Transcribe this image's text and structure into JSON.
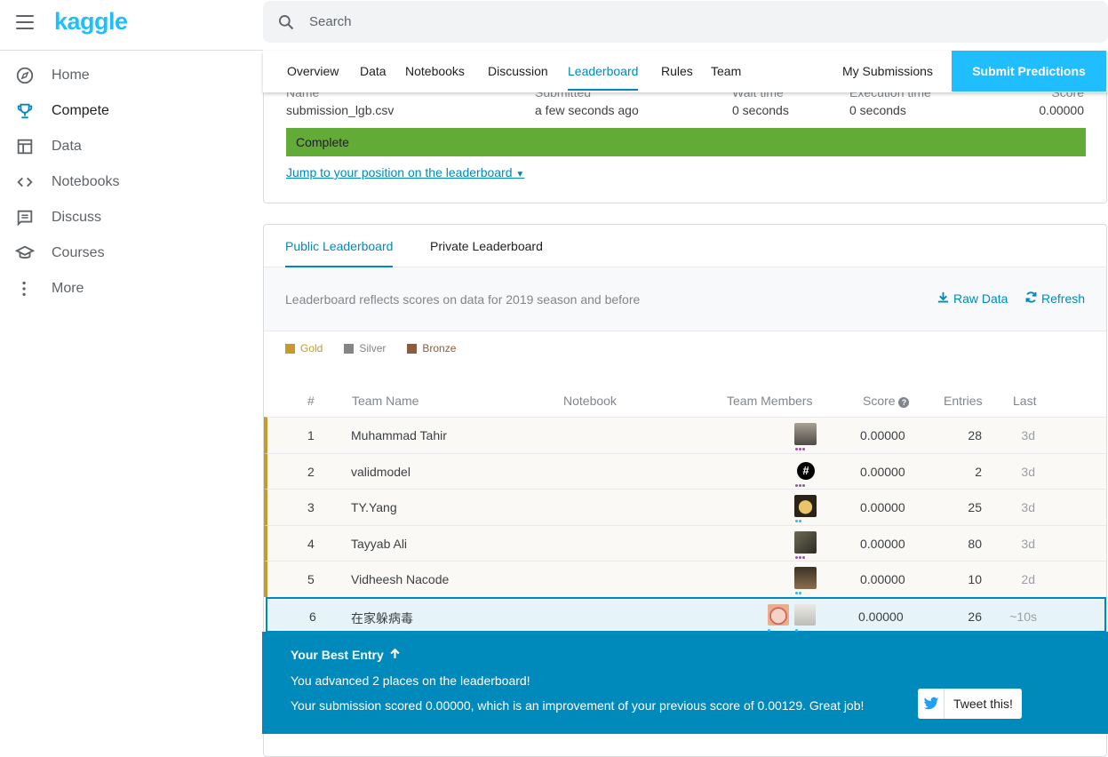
{
  "app": {
    "logo": "kaggle"
  },
  "search": {
    "placeholder": "Search"
  },
  "nav": {
    "items": [
      {
        "label": "Home",
        "icon": "compass-icon"
      },
      {
        "label": "Compete",
        "icon": "trophy-icon",
        "active": true
      },
      {
        "label": "Data",
        "icon": "table-icon"
      },
      {
        "label": "Notebooks",
        "icon": "code-icon"
      },
      {
        "label": "Discuss",
        "icon": "comment-icon"
      },
      {
        "label": "Courses",
        "icon": "school-icon"
      },
      {
        "label": "More",
        "icon": "more-vert-icon"
      }
    ]
  },
  "tabs": {
    "items": [
      "Overview",
      "Data",
      "Notebooks",
      "Discussion",
      "Leaderboard",
      "Rules",
      "Team"
    ],
    "active": "Leaderboard",
    "my_submissions": "My Submissions",
    "submit": "Submit Predictions"
  },
  "submission": {
    "headers": {
      "name": "Name",
      "submitted": "Submitted",
      "wait": "Wait time",
      "exec": "Execution time",
      "score": "Score"
    },
    "values": {
      "name": "submission_lgb.csv",
      "submitted": "a few seconds ago",
      "wait": "0 seconds",
      "exec": "0 seconds",
      "score": "0.00000"
    },
    "status": "Complete",
    "jump_link": "Jump to your position on the leaderboard"
  },
  "leaderboard": {
    "tabs": {
      "public": "Public Leaderboard",
      "private": "Private Leaderboard"
    },
    "info": "Leaderboard reflects scores on data for 2019 season and before",
    "raw_data": "Raw Data",
    "refresh": "Refresh",
    "legend": {
      "gold": {
        "label": "Gold",
        "color": "#c69a2c"
      },
      "silver": {
        "label": "Silver",
        "color": "#858585"
      },
      "bronze": {
        "label": "Bronze",
        "color": "#8e5b3d"
      }
    },
    "columns": {
      "rank": "#",
      "team": "Team Name",
      "notebook": "Notebook",
      "members": "Team Members",
      "score": "Score",
      "entries": "Entries",
      "last": "Last"
    },
    "rows": [
      {
        "rank": "1",
        "team": "Muhammad Tahir",
        "score": "0.00000",
        "entries": "28",
        "last": "3d"
      },
      {
        "rank": "2",
        "team": "validmodel",
        "score": "0.00000",
        "entries": "2",
        "last": "3d"
      },
      {
        "rank": "3",
        "team": "TY.Yang",
        "score": "0.00000",
        "entries": "25",
        "last": "3d"
      },
      {
        "rank": "4",
        "team": "Tayyab Ali",
        "score": "0.00000",
        "entries": "80",
        "last": "3d"
      },
      {
        "rank": "5",
        "team": "Vidheesh Nacode",
        "score": "0.00000",
        "entries": "10",
        "last": "2d"
      },
      {
        "rank": "6",
        "team": "在家躲病毒",
        "score": "0.00000",
        "entries": "26",
        "last": "~10s"
      }
    ]
  },
  "toast": {
    "title": "Your Best Entry",
    "line1": "You advanced 2 places on the leaderboard!",
    "line2": "Your submission scored 0.00000, which is an improvement of your previous score of 0.00129. Great job!",
    "tweet": "Tweet this!"
  }
}
